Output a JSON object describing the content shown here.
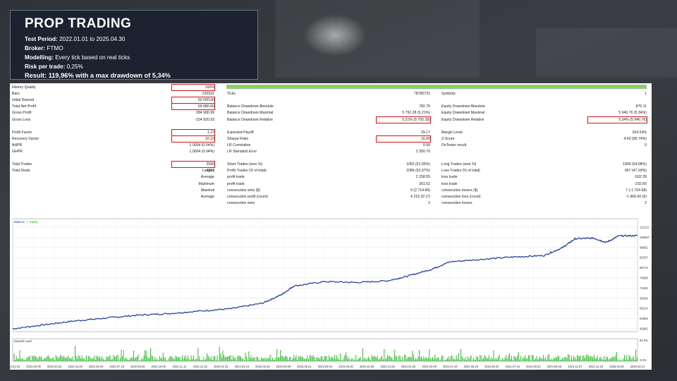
{
  "info": {
    "title": "PROP TRADING",
    "rows": [
      {
        "label": "Test Period:",
        "value": "2022.01.01 to 2025.04.30"
      },
      {
        "label": "Broker:",
        "value": "FTMO"
      },
      {
        "label": "Modelling:",
        "value": "Every tick based on real ticks"
      },
      {
        "label": "Risk per trade:",
        "value": "0,25%"
      }
    ],
    "result": "Result: 119,96% with a max drawdown of 5,34%"
  },
  "stats": {
    "col1": [
      {
        "label": "History Quality",
        "value": "100%",
        "hl": true
      },
      {
        "label": "Bars",
        "value": "232531"
      },
      {
        "label": "Initial Deposit",
        "value": "50 000.00",
        "hl": true
      },
      {
        "label": "Total Net Profit",
        "value": "59 980.06",
        "hl": true
      },
      {
        "label": "Gross Profit",
        "value": "284 900.99"
      },
      {
        "label": "Gross Loss",
        "value": "-224 920.93"
      },
      {
        "label": "",
        "value": ""
      },
      {
        "label": "Profit Factor",
        "value": "1.27",
        "hl": true
      },
      {
        "label": "Recovery Factor",
        "value": "10.10",
        "hl": true
      },
      {
        "label": "AHPR",
        "value": "1.0004 (0.04%)"
      },
      {
        "label": "GHPR",
        "value": "1.0004 (0.04%)"
      },
      {
        "label": "",
        "value": ""
      },
      {
        "label": "Total Trades",
        "value": "2056",
        "hl": true
      },
      {
        "label": "Total Deals",
        "value": "4112"
      }
    ],
    "col1_sub": [
      {
        "label": "Largest",
        "row": 13
      },
      {
        "label": "Average",
        "row": 14
      },
      {
        "label": "Maximum",
        "row": 15
      },
      {
        "label": "Maximal",
        "row": 16
      },
      {
        "label": "Average",
        "row": 17
      }
    ],
    "col2": [
      {
        "label": "",
        "value": ""
      },
      {
        "label": "Ticks",
        "value": "78780731"
      },
      {
        "label": "",
        "value": ""
      },
      {
        "label": "Balance Drawdown Absolute",
        "value": "782.79"
      },
      {
        "label": "Balance Drawdown Maximal",
        "value": "5 792.28 (5.21%)"
      },
      {
        "label": "Balance Drawdown Relative",
        "value": "5.21% (5 792.28)",
        "hl": true
      },
      {
        "label": "",
        "value": ""
      },
      {
        "label": "Expected Payoff",
        "value": "29.17"
      },
      {
        "label": "Sharpe Ratio",
        "value": "16.60",
        "hl": true
      },
      {
        "label": "LR Correlation",
        "value": "0.99"
      },
      {
        "label": "LR Standard Error",
        "value": "3 350.70"
      },
      {
        "label": "",
        "value": ""
      },
      {
        "label": "Short Trades (won %)",
        "value": "1052 (51.05%)"
      },
      {
        "label": "Profit Trades (% of total)",
        "value": "1089 (52.97%)"
      },
      {
        "label": "profit trade",
        "value": "2 258.55"
      },
      {
        "label": "profit trade",
        "value": "261.62"
      },
      {
        "label": "consecutive wins ($)",
        "value": "9 (2 714.84)"
      },
      {
        "label": "consecutive profit (count)",
        "value": "4 215.32 (7)"
      },
      {
        "label": "consecutive wins",
        "value": "2"
      }
    ],
    "col3": [
      {
        "label": "",
        "value": ""
      },
      {
        "label": "Symbols",
        "value": "1"
      },
      {
        "label": "",
        "value": ""
      },
      {
        "label": "Equity Drawdown Absolute",
        "value": "876.11"
      },
      {
        "label": "Equity Drawdown Maximal",
        "value": "5 940.76 (5.34%)"
      },
      {
        "label": "Equity Drawdown Relative",
        "value": "5.34% (5 940.76)",
        "hl": true
      },
      {
        "label": "",
        "value": ""
      },
      {
        "label": "Margin Level",
        "value": "264.53%"
      },
      {
        "label": "Z-Score",
        "value": "4.43 (99.74%)"
      },
      {
        "label": "OnTester result",
        "value": "0"
      },
      {
        "label": "",
        "value": ""
      },
      {
        "label": "",
        "value": ""
      },
      {
        "label": "Long Trades (won %)",
        "value": "1004 (54.98%)"
      },
      {
        "label": "Loss Trades (% of total)",
        "value": "967 (47.03%)"
      },
      {
        "label": "loss trade",
        "value": "-502.39"
      },
      {
        "label": "loss trade",
        "value": "-232.60"
      },
      {
        "label": "consecutive losses ($)",
        "value": "7 (-1 704.68)"
      },
      {
        "label": "consecutive loss (count)",
        "value": "-1 960.60 (6)"
      },
      {
        "label": "consecutive losses",
        "value": "2"
      }
    ]
  },
  "chart_data": [
    {
      "type": "line",
      "legend": [
        "Balance",
        "Equity"
      ],
      "colors": {
        "balance": "#1f3a93",
        "equity": "#22a822"
      },
      "ylim": [
        50000,
        115000
      ],
      "y_ticks": [
        "112211",
        "105587",
        "98962",
        "92337",
        "85713",
        "79088",
        "72463",
        "65839",
        "59214",
        "52589",
        "45965"
      ],
      "x_ticks": [
        "2022.01.04",
        "2022.02.09",
        "2022.03.23",
        "2022.04.29",
        "2022.06.09",
        "2022.07.19",
        "2022.08.26",
        "2022.10.06",
        "2022.11.11",
        "2022.12.22",
        "2023.01.04",
        "2023.02.15",
        "2023.03.28",
        "2023.05.09",
        "2023.06.21",
        "2023.08.04",
        "2023.09.20",
        "2023.10.26",
        "2023.12.05",
        "2024.01.26",
        "2024.03.08",
        "2024.04.18",
        "2024.05.29",
        "2024.06.03",
        "2024.07.16",
        "2024.08.22",
        "2024.09.26",
        "2024.11.07",
        "2024.12.19",
        "2025.02.06",
        "2025.03.21"
      ],
      "series": [
        {
          "name": "Balance",
          "x": [
            0,
            0.05,
            0.1,
            0.15,
            0.2,
            0.25,
            0.3,
            0.35,
            0.4,
            0.43,
            0.45,
            0.5,
            0.55,
            0.6,
            0.63,
            0.67,
            0.7,
            0.75,
            0.8,
            0.85,
            0.88,
            0.9,
            0.93,
            0.95,
            0.97,
            1.0
          ],
          "values": [
            50000,
            52500,
            55000,
            56800,
            58600,
            59600,
            61200,
            62700,
            66200,
            71500,
            77000,
            79800,
            79200,
            80300,
            83000,
            87500,
            92300,
            93800,
            95300,
            96200,
            101200,
            106800,
            107200,
            104500,
            108600,
            108800
          ]
        }
      ]
    },
    {
      "type": "bar",
      "title": "Deposit Load",
      "y_ticks": [
        "80.0%",
        "0.0%"
      ],
      "description_values": "Deposit load per trade, mostly 5-30%, spikes up to ~50%"
    }
  ]
}
